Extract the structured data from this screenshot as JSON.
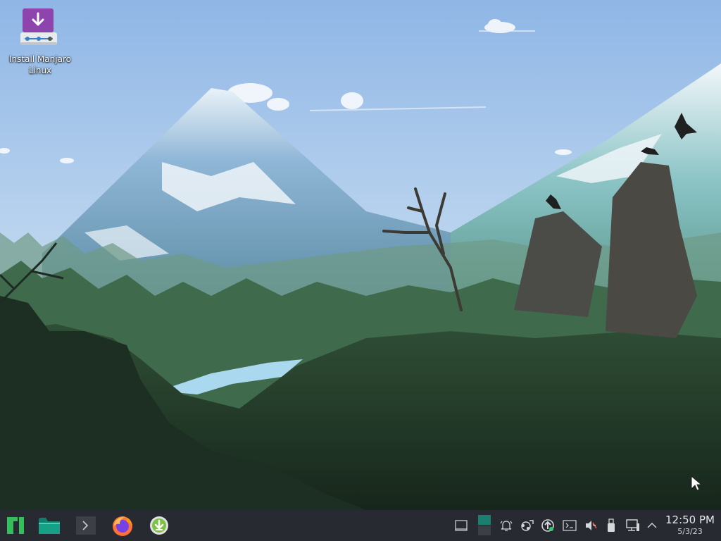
{
  "desktop": {
    "icons": [
      {
        "label": "Install Manjaro Linux",
        "icon": "installer-download-icon",
        "color": "#8e44ad"
      }
    ],
    "wallpaper": "mountains-forest-crows-wallpaper"
  },
  "taskbar": {
    "launchers": [
      {
        "name": "application-menu",
        "icon": "manjaro-logo-icon",
        "color": "#35bf5c"
      },
      {
        "name": "file-manager",
        "icon": "folder-icon",
        "color": "#16a085"
      },
      {
        "name": "terminal",
        "icon": "terminal-icon"
      },
      {
        "name": "firefox",
        "icon": "firefox-icon"
      },
      {
        "name": "software-update",
        "icon": "download-arrow-icon",
        "color": "#9acd32"
      }
    ],
    "tray": [
      {
        "name": "show-desktop",
        "icon": "show-desktop-icon"
      },
      {
        "name": "virtual-desktops",
        "icon": "pager-icon",
        "color": "#1a7f6e"
      },
      {
        "name": "notifications",
        "icon": "bell-icon"
      },
      {
        "name": "kde-connect",
        "icon": "kde-connect-icon"
      },
      {
        "name": "updates",
        "icon": "update-icon"
      },
      {
        "name": "konsole",
        "icon": "console-icon"
      },
      {
        "name": "volume",
        "icon": "volume-muted-icon"
      },
      {
        "name": "removable-devices",
        "icon": "usb-icon"
      },
      {
        "name": "network",
        "icon": "network-icon"
      },
      {
        "name": "expand-tray",
        "icon": "chevron-up-icon"
      }
    ],
    "clock": {
      "time": "12:50 PM",
      "date": "5/3/23"
    }
  }
}
